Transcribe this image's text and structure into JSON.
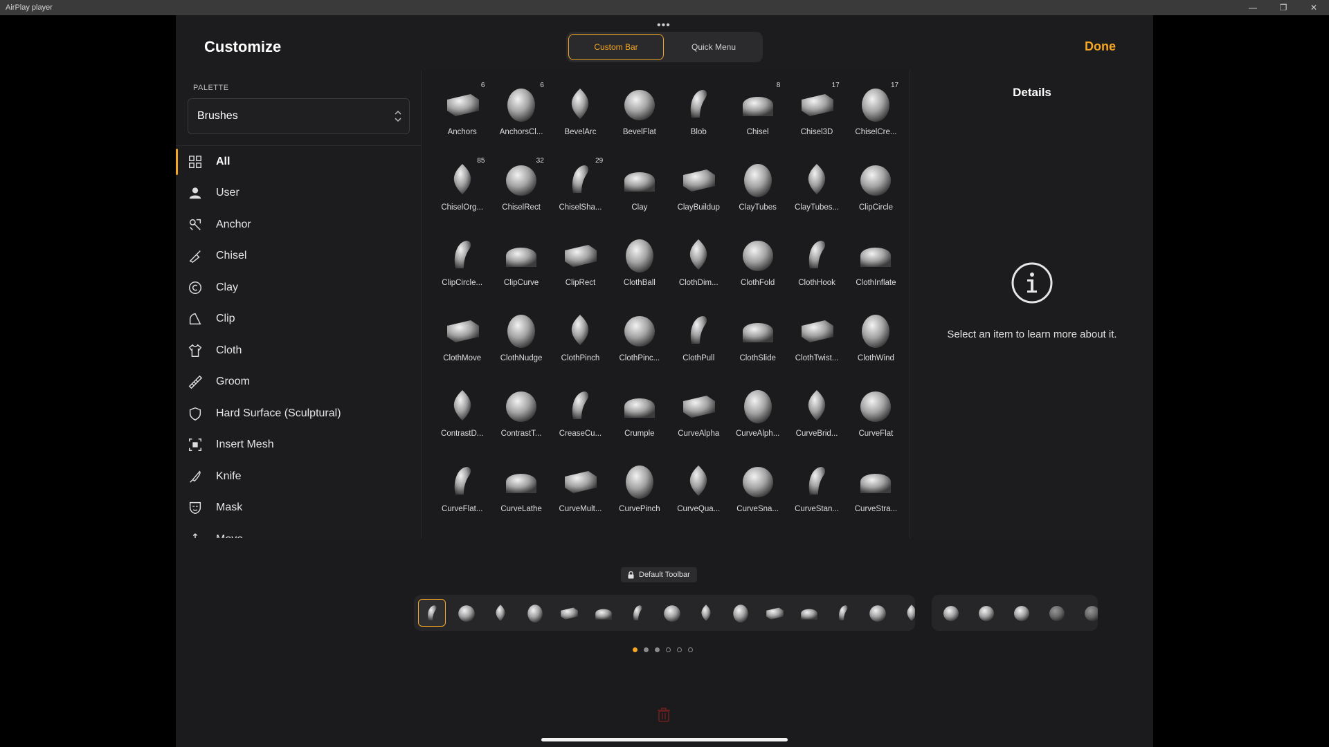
{
  "window": {
    "title": "AirPlay player",
    "controls": [
      "—",
      "❐",
      "✕"
    ]
  },
  "header": {
    "title": "Customize",
    "done_label": "Done",
    "more_dots": "•••",
    "tabs": [
      {
        "label": "Custom Bar",
        "active": true
      },
      {
        "label": "Quick Menu",
        "active": false
      }
    ]
  },
  "palette": {
    "label": "PALETTE",
    "selected": "Brushes"
  },
  "categories": [
    {
      "label": "All",
      "icon": "grid-icon",
      "active": true
    },
    {
      "label": "User",
      "icon": "user-icon"
    },
    {
      "label": "Anchor",
      "icon": "anchor-icon"
    },
    {
      "label": "Chisel",
      "icon": "chisel-icon"
    },
    {
      "label": "Clay",
      "icon": "clay-icon"
    },
    {
      "label": "Clip",
      "icon": "clip-icon"
    },
    {
      "label": "Cloth",
      "icon": "cloth-icon"
    },
    {
      "label": "Groom",
      "icon": "groom-icon"
    },
    {
      "label": "Hard Surface (Sculptural)",
      "icon": "shield-icon"
    },
    {
      "label": "Insert Mesh",
      "icon": "insert-mesh-icon"
    },
    {
      "label": "Knife",
      "icon": "knife-icon"
    },
    {
      "label": "Mask",
      "icon": "mask-icon"
    },
    {
      "label": "Move",
      "icon": "move-icon"
    }
  ],
  "brushes": [
    {
      "name": "Anchors",
      "count": "6"
    },
    {
      "name": "AnchorsCl...",
      "count": "6"
    },
    {
      "name": "BevelArc",
      "count": ""
    },
    {
      "name": "BevelFlat",
      "count": ""
    },
    {
      "name": "Blob",
      "count": ""
    },
    {
      "name": "Chisel",
      "count": "8"
    },
    {
      "name": "Chisel3D",
      "count": "17"
    },
    {
      "name": "ChiselCre...",
      "count": "17"
    },
    {
      "name": "ChiselOrg...",
      "count": "85"
    },
    {
      "name": "ChiselRect",
      "count": "32"
    },
    {
      "name": "ChiselSha...",
      "count": "29"
    },
    {
      "name": "Clay",
      "count": ""
    },
    {
      "name": "ClayBuildup",
      "count": ""
    },
    {
      "name": "ClayTubes",
      "count": ""
    },
    {
      "name": "ClayTubes...",
      "count": ""
    },
    {
      "name": "ClipCircle",
      "count": ""
    },
    {
      "name": "ClipCircle...",
      "count": ""
    },
    {
      "name": "ClipCurve",
      "count": ""
    },
    {
      "name": "ClipRect",
      "count": ""
    },
    {
      "name": "ClothBall",
      "count": ""
    },
    {
      "name": "ClothDim...",
      "count": ""
    },
    {
      "name": "ClothFold",
      "count": ""
    },
    {
      "name": "ClothHook",
      "count": ""
    },
    {
      "name": "ClothInflate",
      "count": ""
    },
    {
      "name": "ClothMove",
      "count": ""
    },
    {
      "name": "ClothNudge",
      "count": ""
    },
    {
      "name": "ClothPinch",
      "count": ""
    },
    {
      "name": "ClothPinc...",
      "count": ""
    },
    {
      "name": "ClothPull",
      "count": ""
    },
    {
      "name": "ClothSlide",
      "count": ""
    },
    {
      "name": "ClothTwist...",
      "count": ""
    },
    {
      "name": "ClothWind",
      "count": ""
    },
    {
      "name": "ContrastD...",
      "count": ""
    },
    {
      "name": "ContrastT...",
      "count": ""
    },
    {
      "name": "CreaseCu...",
      "count": ""
    },
    {
      "name": "Crumple",
      "count": ""
    },
    {
      "name": "CurveAlpha",
      "count": ""
    },
    {
      "name": "CurveAlph...",
      "count": ""
    },
    {
      "name": "CurveBrid...",
      "count": ""
    },
    {
      "name": "CurveFlat",
      "count": ""
    },
    {
      "name": "CurveFlat...",
      "count": ""
    },
    {
      "name": "CurveLathe",
      "count": ""
    },
    {
      "name": "CurveMult...",
      "count": ""
    },
    {
      "name": "CurvePinch",
      "count": ""
    },
    {
      "name": "CurveQua...",
      "count": ""
    },
    {
      "name": "CurveSna...",
      "count": ""
    },
    {
      "name": "CurveStan...",
      "count": ""
    },
    {
      "name": "CurveStra...",
      "count": ""
    }
  ],
  "details": {
    "title": "Details",
    "message": "Select an item to learn more about it."
  },
  "toolbar": {
    "badge_label": "Default Toolbar",
    "page_count": 6,
    "current_page": 1
  },
  "colors": {
    "accent": "#f5a623",
    "background": "#1c1c1e",
    "trash": "#7a2020"
  }
}
